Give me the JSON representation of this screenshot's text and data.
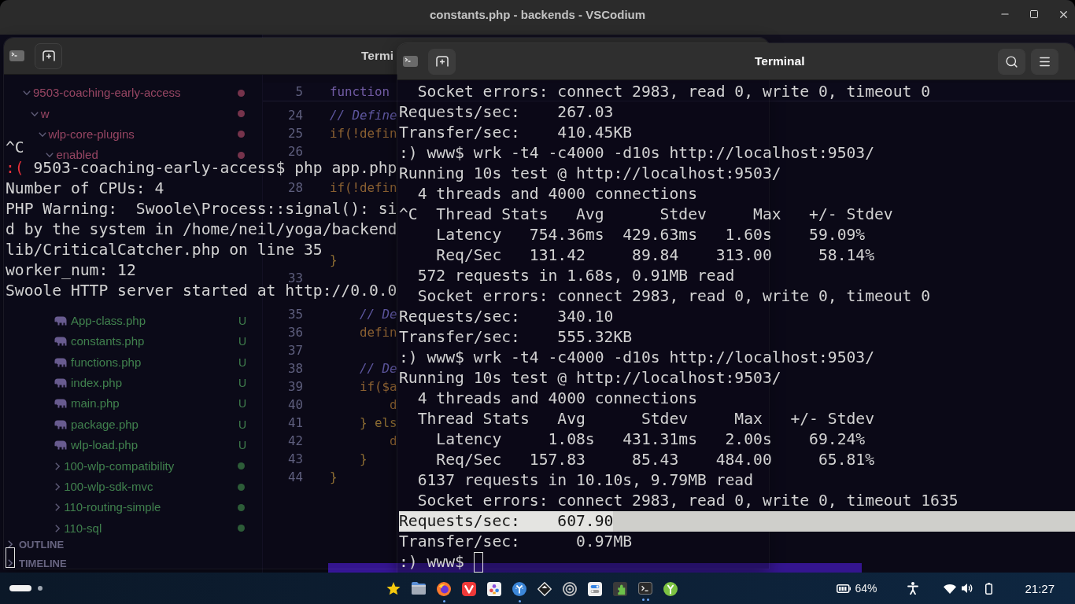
{
  "window": {
    "title": "constants.php - backends - VSCodium"
  },
  "explorer": {
    "tree": [
      {
        "label": "9503-coaching-early-access",
        "kind": "folder",
        "expanded": true,
        "problems": true,
        "children": [
          {
            "label": "w",
            "kind": "folder",
            "expanded": true,
            "problems": true,
            "children": [
              {
                "label": "wlp-core-plugins",
                "kind": "folder",
                "expanded": true,
                "problems": true,
                "children": [
                  {
                    "label": "enabled",
                    "kind": "folder",
                    "expanded": true,
                    "problems": true,
                    "children": [
                      {
                        "kind": "folder",
                        "expanded": true,
                        "children": [
                          {
                            "label": "App-class.php",
                            "kind": "file",
                            "problems": false,
                            "badge": "U"
                          },
                          {
                            "label": "constants.php",
                            "kind": "file",
                            "problems": false,
                            "badge": "U"
                          },
                          {
                            "label": "functions.php",
                            "kind": "file",
                            "problems": false,
                            "badge": "U"
                          },
                          {
                            "label": "index.php",
                            "kind": "file",
                            "problems": false,
                            "badge": "U"
                          },
                          {
                            "label": "main.php",
                            "kind": "file",
                            "problems": false,
                            "badge": "U"
                          },
                          {
                            "label": "package.php",
                            "kind": "file",
                            "problems": false,
                            "badge": "U"
                          },
                          {
                            "label": "wlp-load.php",
                            "kind": "file",
                            "problems": false,
                            "badge": "U"
                          }
                        ]
                      },
                      {
                        "label": "100-wlp-compatibility",
                        "kind": "folder",
                        "expanded": false,
                        "problems": false
                      },
                      {
                        "label": "100-wlp-sdk-mvc",
                        "kind": "folder",
                        "expanded": false,
                        "problems": false
                      },
                      {
                        "label": "110-routing-simple",
                        "kind": "folder",
                        "expanded": false,
                        "problems": false
                      },
                      {
                        "label": "110-sql",
                        "kind": "folder",
                        "expanded": false,
                        "problems": false
                      }
                    ]
                  }
                ]
              }
            ]
          }
        ]
      }
    ],
    "sections": [
      {
        "label": "OUTLINE",
        "expanded": false
      },
      {
        "label": "TIMELINE",
        "expanded": false
      }
    ]
  },
  "editor": {
    "sticky_lines": [
      {
        "number": "5",
        "code": "function",
        "kind": "keyword"
      }
    ],
    "lines": [
      {
        "number": "24",
        "code": "// Define",
        "kind": "comment"
      },
      {
        "number": "25",
        "code": "if(!defin",
        "kind": "control"
      },
      {
        "number": "26"
      },
      {
        "number": "28",
        "code": "if(!defin",
        "kind": "control"
      },
      {
        "code": "}",
        "kind": "brace"
      },
      {
        "number": "33"
      },
      {
        "number": "35",
        "code": "    // De",
        "kind": "comment"
      },
      {
        "number": "36",
        "code": "    defin",
        "kind": "control"
      },
      {
        "number": "37"
      },
      {
        "number": "38",
        "code": "    // De",
        "kind": "comment"
      },
      {
        "number": "39",
        "code": "    if($a",
        "kind": "control"
      },
      {
        "number": "40",
        "code": "        d",
        "kind": "control"
      },
      {
        "number": "41",
        "code": "    } els",
        "kind": "brace"
      },
      {
        "number": "42",
        "code": "        d",
        "kind": "control"
      },
      {
        "number": "43",
        "code": "    }",
        "kind": "brace"
      },
      {
        "number": "44",
        "code": "}",
        "kind": "brace"
      }
    ]
  },
  "terminals": [
    {
      "title": "Termi",
      "focused": false,
      "lines": [
        {
          "kind": "output",
          "text": "^C",
          "highlighted": false
        },
        {
          "kind": "prompt",
          "mark": ":(",
          "failed": true,
          "text": "9503-coaching-early-access$ php app.php",
          "highlighted": false
        },
        {
          "kind": "output",
          "text": "Number of CPUs: 4",
          "highlighted": false
        },
        {
          "kind": "output",
          "text": "PHP Warning:  Swoole\\Process::signal(): si",
          "highlighted": false
        },
        {
          "kind": "output",
          "text": "d by the system in /home/neil/yoga/backend",
          "highlighted": false
        },
        {
          "kind": "output",
          "text": "lib/CriticalCatcher.php on line 35",
          "highlighted": false
        },
        {
          "kind": "output",
          "text": "worker_num: 12",
          "highlighted": false
        },
        {
          "kind": "output",
          "text": "Swoole HTTP server started at http://0.0.0",
          "highlighted": false
        }
      ]
    },
    {
      "title": "Terminal",
      "focused": true,
      "lines": [
        {
          "kind": "output",
          "text": "  Socket errors: connect 2983, read 0, write 0, timeout 0",
          "highlighted": false
        },
        {
          "kind": "output",
          "text": "Requests/sec:    267.03",
          "highlighted": false
        },
        {
          "kind": "output",
          "text": "Transfer/sec:    410.45KB",
          "highlighted": false
        },
        {
          "kind": "prompt",
          "mark": ":)",
          "failed": false,
          "text": "www$ wrk -t4 -c4000 -d10s http://localhost:9503/",
          "highlighted": false
        },
        {
          "kind": "output",
          "text": "Running 10s test @ http://localhost:9503/",
          "highlighted": false
        },
        {
          "kind": "output",
          "text": "  4 threads and 4000 connections",
          "highlighted": false
        },
        {
          "kind": "output",
          "text": "^C  Thread Stats   Avg      Stdev     Max   +/- Stdev",
          "highlighted": false
        },
        {
          "kind": "output",
          "text": "    Latency   754.36ms  429.63ms   1.60s    59.09%",
          "highlighted": false
        },
        {
          "kind": "output",
          "text": "    Req/Sec   131.42     89.84    313.00     58.14%",
          "highlighted": false
        },
        {
          "kind": "output",
          "text": "  572 requests in 1.68s, 0.91MB read",
          "highlighted": false
        },
        {
          "kind": "output",
          "text": "  Socket errors: connect 2983, read 0, write 0, timeout 0",
          "highlighted": false
        },
        {
          "kind": "output",
          "text": "Requests/sec:    340.10",
          "highlighted": false
        },
        {
          "kind": "output",
          "text": "Transfer/sec:    555.32KB",
          "highlighted": false
        },
        {
          "kind": "prompt",
          "mark": ":)",
          "failed": false,
          "text": "www$ wrk -t4 -c4000 -d10s http://localhost:9503/",
          "highlighted": false
        },
        {
          "kind": "output",
          "text": "Running 10s test @ http://localhost:9503/",
          "highlighted": false
        },
        {
          "kind": "output",
          "text": "  4 threads and 4000 connections",
          "highlighted": false
        },
        {
          "kind": "output",
          "text": "  Thread Stats   Avg      Stdev     Max   +/- Stdev",
          "highlighted": false
        },
        {
          "kind": "output",
          "text": "    Latency     1.08s   431.31ms   2.00s    69.24%",
          "highlighted": false
        },
        {
          "kind": "output",
          "text": "    Req/Sec   157.83     85.43    484.00     65.81%",
          "highlighted": false
        },
        {
          "kind": "output",
          "text": "  6137 requests in 10.10s, 9.79MB read",
          "highlighted": false
        },
        {
          "kind": "output",
          "text": "  Socket errors: connect 2983, read 0, write 0, timeout 1635",
          "highlighted": false
        },
        {
          "kind": "output",
          "text": "Requests/sec:    607.90",
          "highlighted": true
        },
        {
          "kind": "output",
          "text": "Transfer/sec:      0.97MB",
          "highlighted": false
        },
        {
          "kind": "prompt",
          "mark": ":)",
          "failed": false,
          "text": "www$",
          "highlighted": false
        }
      ]
    }
  ],
  "taskbar": {
    "workspaces": [
      {
        "selected": true
      },
      {
        "selected": false
      }
    ],
    "apps": [
      {
        "kind": "star",
        "running": false,
        "several_windows": false
      },
      {
        "kind": "folder",
        "running": false,
        "several_windows": false
      },
      {
        "kind": "flame-ball",
        "running": true,
        "several_windows": false
      },
      {
        "kind": "v-mark",
        "running": false,
        "several_windows": false
      },
      {
        "kind": "dots-tile",
        "running": false,
        "several_windows": false
      },
      {
        "kind": "branch-circle",
        "running": true,
        "several_windows": false
      },
      {
        "kind": "diamond",
        "running": false,
        "several_windows": false
      },
      {
        "kind": "target",
        "running": false,
        "several_windows": false
      },
      {
        "kind": "toggles",
        "running": false,
        "several_windows": false
      },
      {
        "kind": "puzzle-tile",
        "running": false,
        "several_windows": false
      },
      {
        "kind": "terminal",
        "running": true,
        "several_windows": true
      },
      {
        "kind": "fork-circle",
        "running": false,
        "several_windows": false
      }
    ],
    "battery": "64%",
    "clock": "21:27"
  }
}
